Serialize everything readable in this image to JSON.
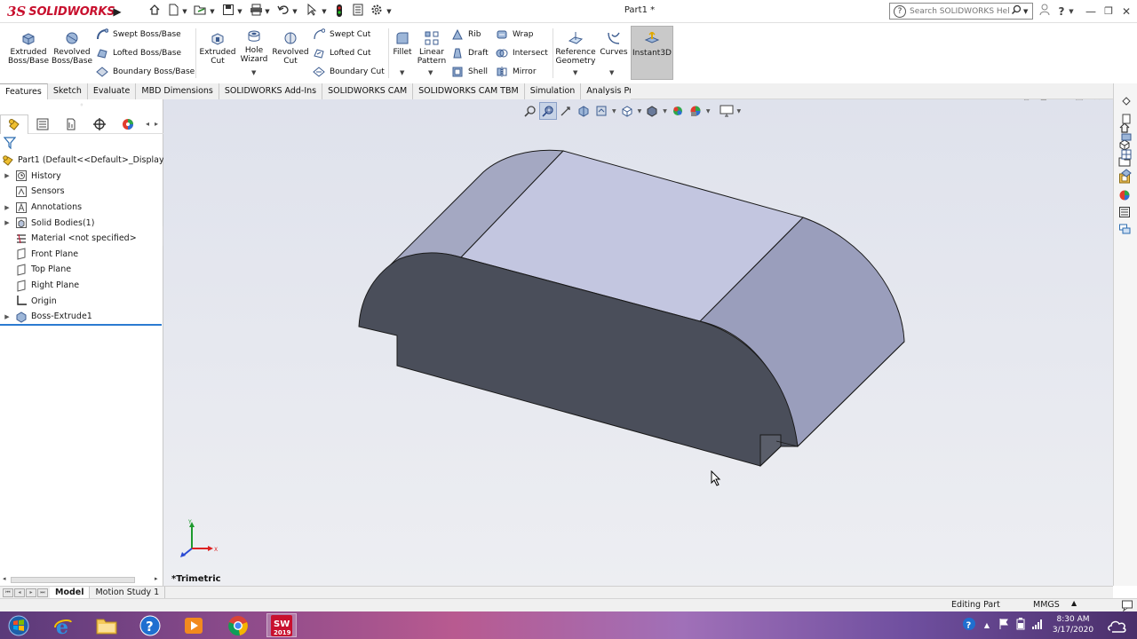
{
  "titlebar": {
    "brand_prefix": "3S",
    "brand_name": "SOLIDWORKS",
    "doc_title": "Part1 *",
    "help_search_placeholder": "Search SOLIDWORKS Help"
  },
  "commands": {
    "extruded_boss": "Extruded Boss/Base",
    "revolved_boss": "Revolved Boss/Base",
    "swept_boss": "Swept Boss/Base",
    "lofted_boss": "Lofted Boss/Base",
    "boundary_boss": "Boundary Boss/Base",
    "extruded_cut": "Extruded Cut",
    "hole_wizard": "Hole Wizard",
    "revolved_cut": "Revolved Cut",
    "swept_cut": "Swept Cut",
    "lofted_cut": "Lofted Cut",
    "boundary_cut": "Boundary Cut",
    "fillet": "Fillet",
    "linear_pattern": "Linear Pattern",
    "rib": "Rib",
    "draft": "Draft",
    "shell": "Shell",
    "wrap": "Wrap",
    "intersect": "Intersect",
    "mirror": "Mirror",
    "reference_geometry": "Reference Geometry",
    "curves": "Curves",
    "instant3d": "Instant3D"
  },
  "tabs": [
    {
      "label": "Features",
      "active": true
    },
    {
      "label": "Sketch"
    },
    {
      "label": "Evaluate"
    },
    {
      "label": "MBD Dimensions"
    },
    {
      "label": "SOLIDWORKS Add-Ins"
    },
    {
      "label": "SOLIDWORKS CAM"
    },
    {
      "label": "SOLIDWORKS CAM TBM"
    },
    {
      "label": "Simulation"
    },
    {
      "label": "Analysis Preparation"
    }
  ],
  "tree": {
    "root": "Part1  (Default<<Default>_Display",
    "items": [
      {
        "label": "History",
        "expandable": true
      },
      {
        "label": "Sensors"
      },
      {
        "label": "Annotations",
        "expandable": true
      },
      {
        "label": "Solid Bodies(1)",
        "expandable": true
      },
      {
        "label": "Material <not specified>"
      },
      {
        "label": "Front Plane"
      },
      {
        "label": "Top Plane"
      },
      {
        "label": "Right Plane"
      },
      {
        "label": "Origin"
      },
      {
        "label": "Boss-Extrude1",
        "expandable": true
      }
    ]
  },
  "viewport": {
    "view_name": "*Trimetric"
  },
  "bottom_tabs": [
    {
      "label": "Model",
      "active": true
    },
    {
      "label": "Motion Study 1"
    }
  ],
  "status": {
    "editing": "Editing Part",
    "units": "MMGS"
  },
  "taskbar": {
    "sw_badge": "2019",
    "time": "8:30 AM",
    "date": "3/17/2020"
  },
  "colors": {
    "brand": "#c8102e",
    "model_dark": "#4a4e5a",
    "model_light": "#c3c6e0",
    "selection": "#2b7bd1"
  }
}
